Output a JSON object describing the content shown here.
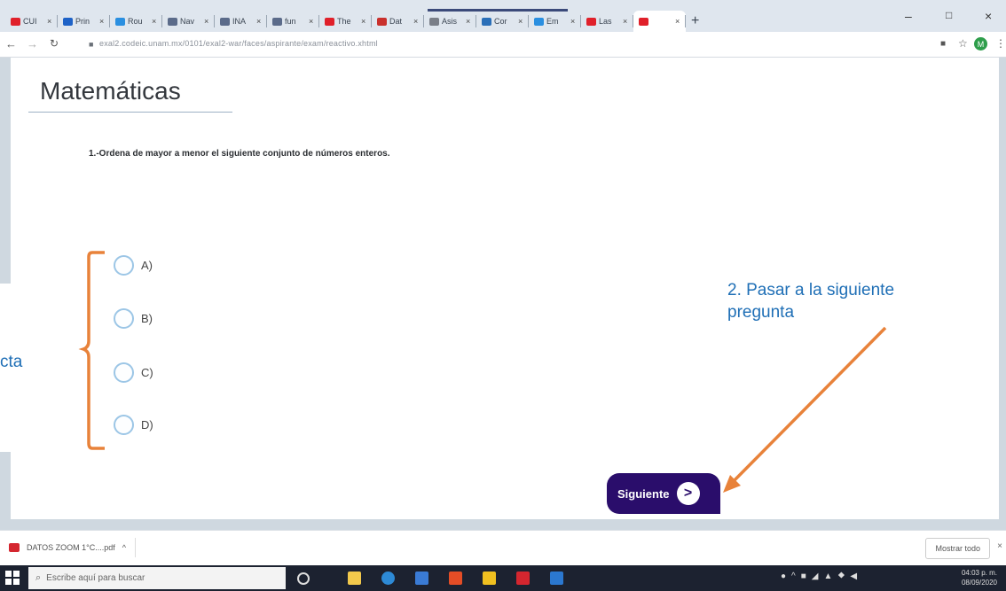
{
  "browser": {
    "tabs": [
      {
        "title": "CUI",
        "favicon_color": "#e0202a"
      },
      {
        "title": "Prin",
        "favicon_color": "#1e62c7"
      },
      {
        "title": "Rou",
        "favicon_color": "#2a8fe0"
      },
      {
        "title": "Nav",
        "favicon_color": "#5b6b8a"
      },
      {
        "title": "INA",
        "favicon_color": "#5b6b8a"
      },
      {
        "title": "fun",
        "favicon_color": "#5b6b8a"
      },
      {
        "title": "The",
        "favicon_color": "#e0202a"
      },
      {
        "title": "Dat",
        "favicon_color": "#c9302c"
      },
      {
        "title": "Asis",
        "favicon_color": "#7a7f88"
      },
      {
        "title": "Cor",
        "favicon_color": "#2a6fb8"
      },
      {
        "title": "Em",
        "favicon_color": "#2a8fe0"
      },
      {
        "title": "Las",
        "favicon_color": "#e0202a"
      },
      {
        "title": "",
        "favicon_color": "#e0202a"
      }
    ],
    "new_tab": "+",
    "window_controls": {
      "minimize": "–",
      "maximize": "□",
      "close": "×"
    },
    "url": "exal2.codeic.unam.mx/0101/exal2-war/faces/aspirante/exam/reactivo.xhtml",
    "profile_initial": "M"
  },
  "page": {
    "title": "Matemáticas",
    "question": "1.-Ordena de mayor a menor el siguiente conjunto de números enteros.",
    "options": [
      "A)",
      "B)",
      "C)",
      "D)"
    ],
    "next_button": "Siguiente",
    "next_icon": ">"
  },
  "annotations": {
    "next_note": "2. Pasar a la siguiente pregunta",
    "left_note": "cta",
    "bracket_color": "#e8823a",
    "arrow_color": "#e8823a"
  },
  "downloads": {
    "file": "DATOS ZOOM 1°C....pdf",
    "caret": "^",
    "show_all": "Mostrar todo",
    "close": "×"
  },
  "taskbar": {
    "search_placeholder": "Escribe aquí para buscar",
    "time": "04:03 p. m.",
    "date": "08/09/2020"
  }
}
